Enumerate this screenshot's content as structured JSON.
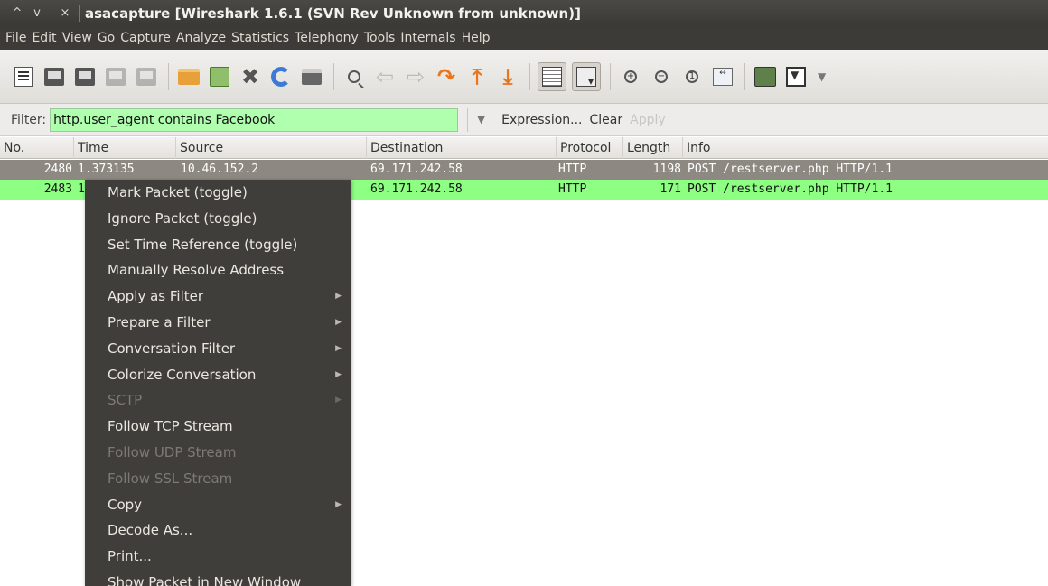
{
  "window": {
    "controls": [
      "^",
      "v",
      "×"
    ],
    "title": "asacapture  [Wireshark 1.6.1  (SVN Rev Unknown from unknown)]"
  },
  "menubar": [
    "File",
    "Edit",
    "View",
    "Go",
    "Capture",
    "Analyze",
    "Statistics",
    "Telephony",
    "Tools",
    "Internals",
    "Help"
  ],
  "toolbar": {
    "icons": [
      "interface-list-icon",
      "capture-options-icon",
      "start-capture-icon",
      "stop-capture-icon",
      "restart-capture-icon",
      "open-file-icon",
      "save-file-icon",
      "close-file-icon",
      "reload-icon",
      "print-icon",
      "find-packet-icon",
      "go-back-icon",
      "go-forward-icon",
      "go-to-packet-icon",
      "go-first-icon",
      "go-last-icon",
      "colorize-icon",
      "auto-scroll-icon",
      "zoom-in-icon",
      "zoom-out-icon",
      "normal-size-icon",
      "resize-columns-icon",
      "capture-filters-icon",
      "display-filters-icon"
    ]
  },
  "filter": {
    "label": "Filter:",
    "value": "http.user_agent contains Facebook",
    "dropdown_glyph": "▼",
    "expression": "Expression...",
    "clear": "Clear",
    "apply": "Apply",
    "input_color": "#afffaf"
  },
  "packet_list": {
    "columns": [
      "No.",
      "Time",
      "Source",
      "Destination",
      "Protocol",
      "Length",
      "Info"
    ],
    "rows": [
      {
        "no": "2480",
        "time": "1.373135",
        "source": "10.46.152.2",
        "destination": "69.171.242.58",
        "protocol": "HTTP",
        "length": "1198",
        "info": "POST /restserver.php HTTP/1.1",
        "state": "selected"
      },
      {
        "no": "2483",
        "time": "1",
        "source": "",
        "destination": "69.171.242.58",
        "protocol": "HTTP",
        "length": "171",
        "info": "POST /restserver.php HTTP/1.1",
        "state": "colored"
      }
    ],
    "selected_color": "#8d8982",
    "row_color": "#8dff82"
  },
  "context_menu": {
    "items": [
      {
        "label": "Mark Packet (toggle)",
        "submenu": false,
        "enabled": true
      },
      {
        "label": "Ignore Packet (toggle)",
        "submenu": false,
        "enabled": true
      },
      {
        "label": "Set Time Reference (toggle)",
        "submenu": false,
        "enabled": true
      },
      {
        "label": "Manually Resolve Address",
        "submenu": false,
        "enabled": true
      },
      {
        "label": "Apply as Filter",
        "submenu": true,
        "enabled": true
      },
      {
        "label": "Prepare a Filter",
        "submenu": true,
        "enabled": true
      },
      {
        "label": "Conversation Filter",
        "submenu": true,
        "enabled": true
      },
      {
        "label": "Colorize Conversation",
        "submenu": true,
        "enabled": true
      },
      {
        "label": "SCTP",
        "submenu": true,
        "enabled": false
      },
      {
        "label": "Follow TCP Stream",
        "submenu": false,
        "enabled": true
      },
      {
        "label": "Follow UDP Stream",
        "submenu": false,
        "enabled": false
      },
      {
        "label": "Follow SSL Stream",
        "submenu": false,
        "enabled": false
      },
      {
        "label": "Copy",
        "submenu": true,
        "enabled": true
      },
      {
        "label": "Decode As...",
        "submenu": false,
        "enabled": true
      },
      {
        "label": "Print...",
        "submenu": false,
        "enabled": true
      },
      {
        "label": "Show Packet in New Window",
        "submenu": false,
        "enabled": true
      }
    ],
    "submenu_glyph": "▶",
    "background": "#403e3a"
  }
}
